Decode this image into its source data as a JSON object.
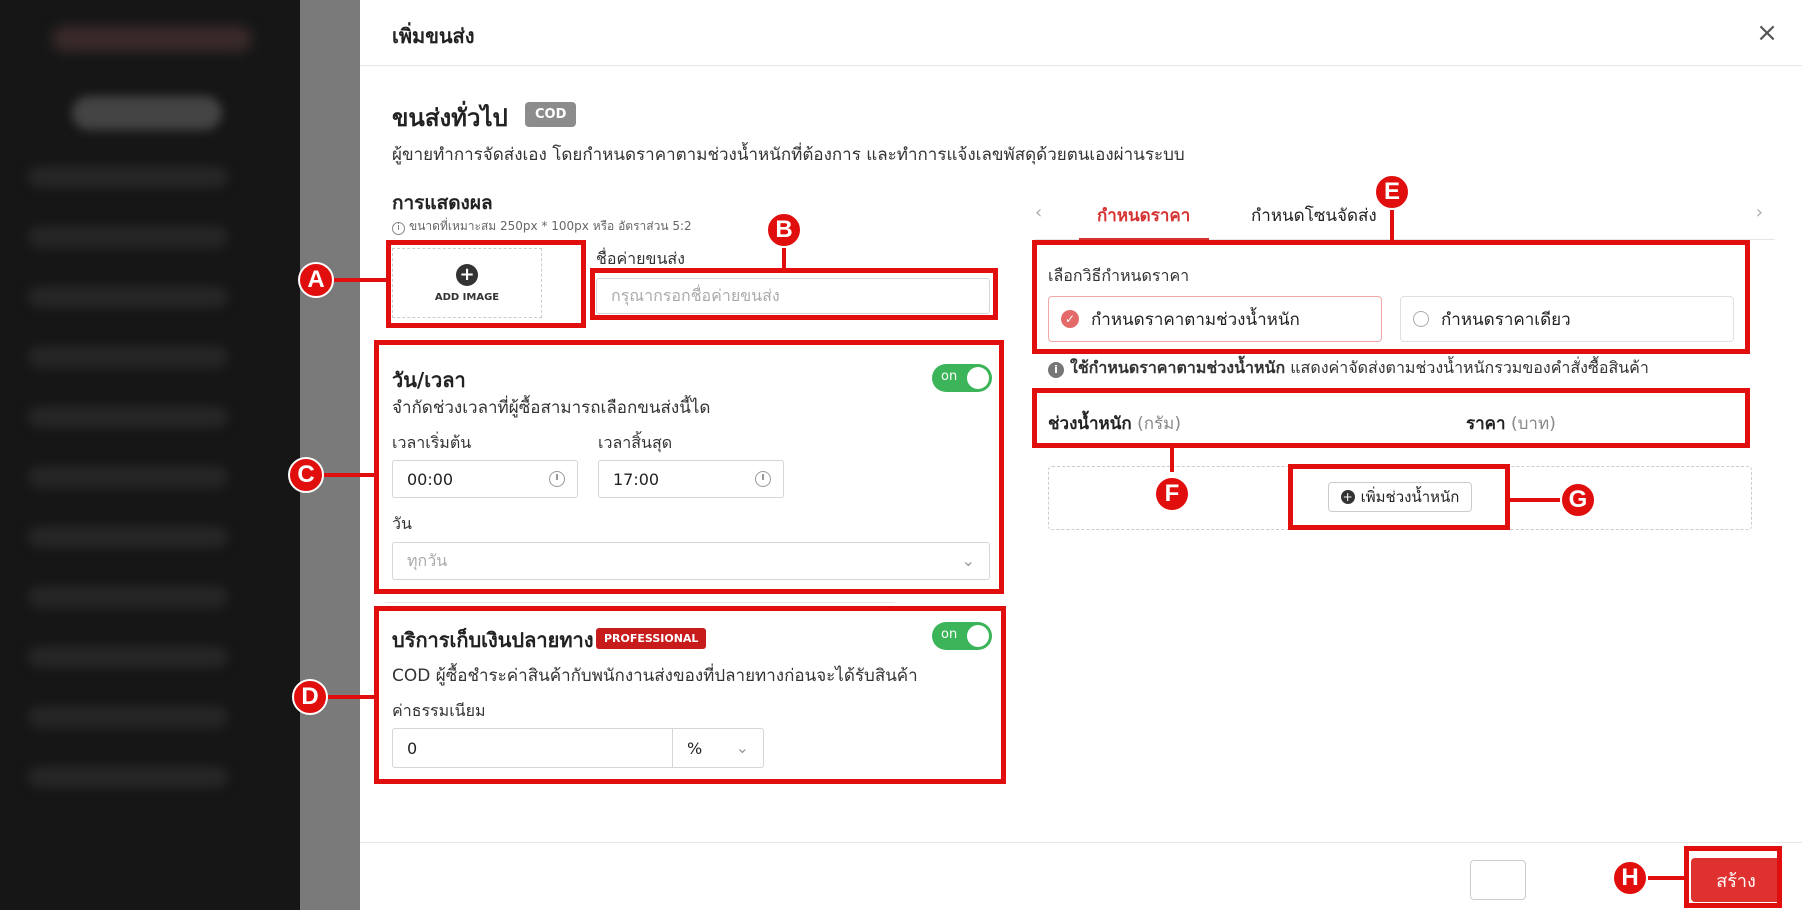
{
  "drawer": {
    "title": "เพิ่มขนส่ง",
    "close_icon": "close-icon"
  },
  "header": {
    "heading": "ขนส่งทั่วไป",
    "badge": "COD",
    "description": "ผู้ขายทำการจัดส่งเอง โดยกำหนดราคาตามช่วงน้ำหนักที่ต้องการ และทำการแจ้งเลขพัสดุด้วยตนเองผ่านระบบ"
  },
  "display": {
    "label": "การแสดงผล",
    "hint": "ขนาดที่เหมาะสม 250px * 100px หรือ อัตราส่วน 5:2",
    "add_image": "ADD IMAGE",
    "name_label": "ชื่อค่ายขนส่ง",
    "name_placeholder": "กรุณากรอกชื่อค่ายขนส่ง"
  },
  "datetime": {
    "title": "วัน/เวลา",
    "toggle": "on",
    "description": "จำกัดช่วงเวลาที่ผู้ซื้อสามารถเลือกขนส่งนี้ได",
    "start_label": "เวลาเริ่มต้น",
    "start_value": "00:00",
    "end_label": "เวลาสิ้นสุด",
    "end_value": "17:00",
    "day_label": "วัน",
    "day_placeholder": "ทุกวัน"
  },
  "cod": {
    "title": "บริการเก็บเงินปลายทาง",
    "badge": "PROFESSIONAL",
    "toggle": "on",
    "description": "COD ผู้ซื้อชำระค่าสินค้ากับพนักงานส่งของที่ปลายทางก่อนจะได้รับสินค้า",
    "fee_label": "ค่าธรรมเนียม",
    "fee_value": "0",
    "fee_unit": "%"
  },
  "tabs": {
    "items": [
      "กำหนดราคา",
      "กำหนดโซนจัดส่ง"
    ],
    "active": 0
  },
  "pricing": {
    "method_label": "เลือกวิธีกำหนดราคา",
    "option_weight": "กำหนดราคาตามช่วงน้ำหนัก",
    "option_single": "กำหนดราคาเดียว",
    "info_bold": "ใช้กำหนดราคาตามช่วงน้ำหนัก",
    "info_rest": " แสดงค่าจัดส่งตามช่วงน้ำหนักรวมของคำสั่งซื้อสินค้า",
    "col_weight": "ช่วงน้ำหนัก",
    "col_weight_unit": " (กรัม)",
    "col_price": "ราคา",
    "col_price_unit": " (บาท)",
    "add_weight": "เพิ่มช่วงน้ำหนัก"
  },
  "footer": {
    "create": "สร้าง"
  },
  "annotations": [
    "A",
    "B",
    "C",
    "D",
    "E",
    "F",
    "G",
    "H"
  ],
  "colors": {
    "accent": "#d63333",
    "annotation": "#e10e0e",
    "toggle_on": "#3cb55a",
    "badge_gray": "#8c8c8c"
  }
}
